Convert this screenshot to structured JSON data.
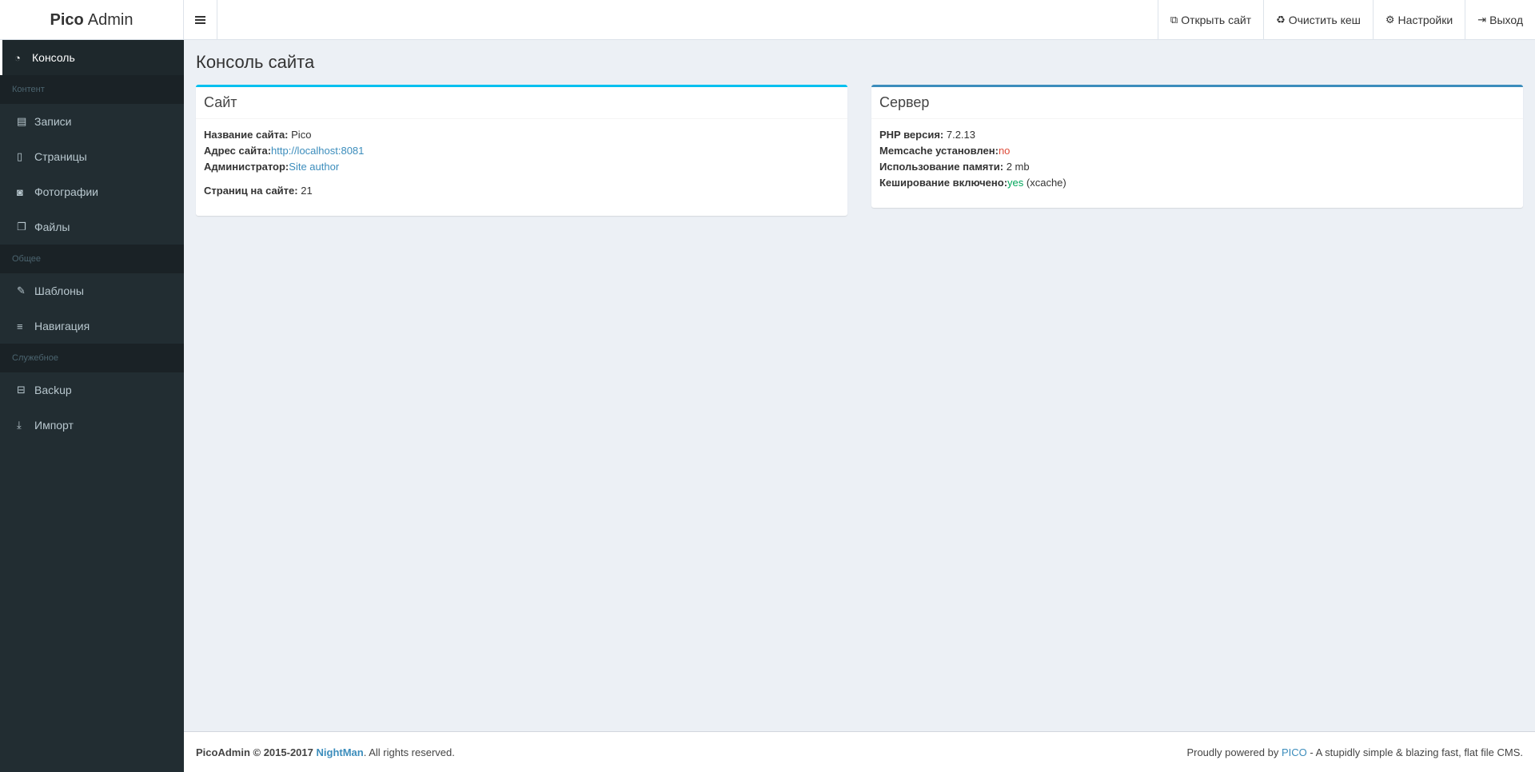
{
  "header": {
    "logo_bold": "Pico",
    "logo_rest": "Admin",
    "nav": [
      {
        "icon": "external-link-icon",
        "label": "Открыть сайт"
      },
      {
        "icon": "recycle-icon",
        "label": "Очистить кеш"
      },
      {
        "icon": "gears-icon",
        "label": "Настройки"
      },
      {
        "icon": "sign-out-icon",
        "label": "Выход"
      }
    ]
  },
  "sidebar": {
    "console": {
      "icon": "dashboard-icon",
      "label": "Консоль"
    },
    "section_content": "Контент",
    "posts": {
      "icon": "newspaper-icon",
      "label": "Записи"
    },
    "pages": {
      "icon": "file-icon",
      "label": "Страницы"
    },
    "photos": {
      "icon": "camera-icon",
      "label": "Фотографии"
    },
    "files": {
      "icon": "files-icon",
      "label": "Файлы"
    },
    "section_general": "Общее",
    "templates": {
      "icon": "paint-brush-icon",
      "label": "Шаблоны"
    },
    "navigation": {
      "icon": "bars-icon",
      "label": "Навигация"
    },
    "section_service": "Служебное",
    "backup": {
      "icon": "hdd-icon",
      "label": "Backup"
    },
    "import": {
      "icon": "download-icon",
      "label": "Импорт"
    }
  },
  "main": {
    "title": "Консоль сайта",
    "site_box": {
      "title": "Сайт",
      "name_label": "Название сайта:",
      "name_value": "Pico",
      "url_label": "Адрес сайта:",
      "url_value": "http://localhost:8081",
      "admin_label": "Администратор:",
      "admin_value": "Site author",
      "pages_label": "Страниц на сайте:",
      "pages_value": "21"
    },
    "server_box": {
      "title": "Сервер",
      "php_label": "PHP версия:",
      "php_value": "7.2.13",
      "memcache_label": "Memcache установлен:",
      "memcache_value": "no",
      "memory_label": "Использование памяти:",
      "memory_value": "2 mb",
      "cache_label": "Кеширование включено:",
      "cache_value": "yes",
      "cache_extra": "(xcache)"
    }
  },
  "footer": {
    "copyright": "PicoAdmin © 2015-2017",
    "author": "NightMan",
    "rights": ". All rights reserved.",
    "powered_prefix": "Proudly powered by",
    "powered_link": "PICO",
    "powered_suffix": "- A stupidly simple & blazing fast, flat file CMS."
  },
  "colors": {
    "sidebar_bg": "#222d32",
    "content_bg": "#ecf0f5",
    "accent": "#3c8dbc",
    "info_border": "#00c0ef",
    "danger": "#dd4b39",
    "success": "#00a65a"
  }
}
